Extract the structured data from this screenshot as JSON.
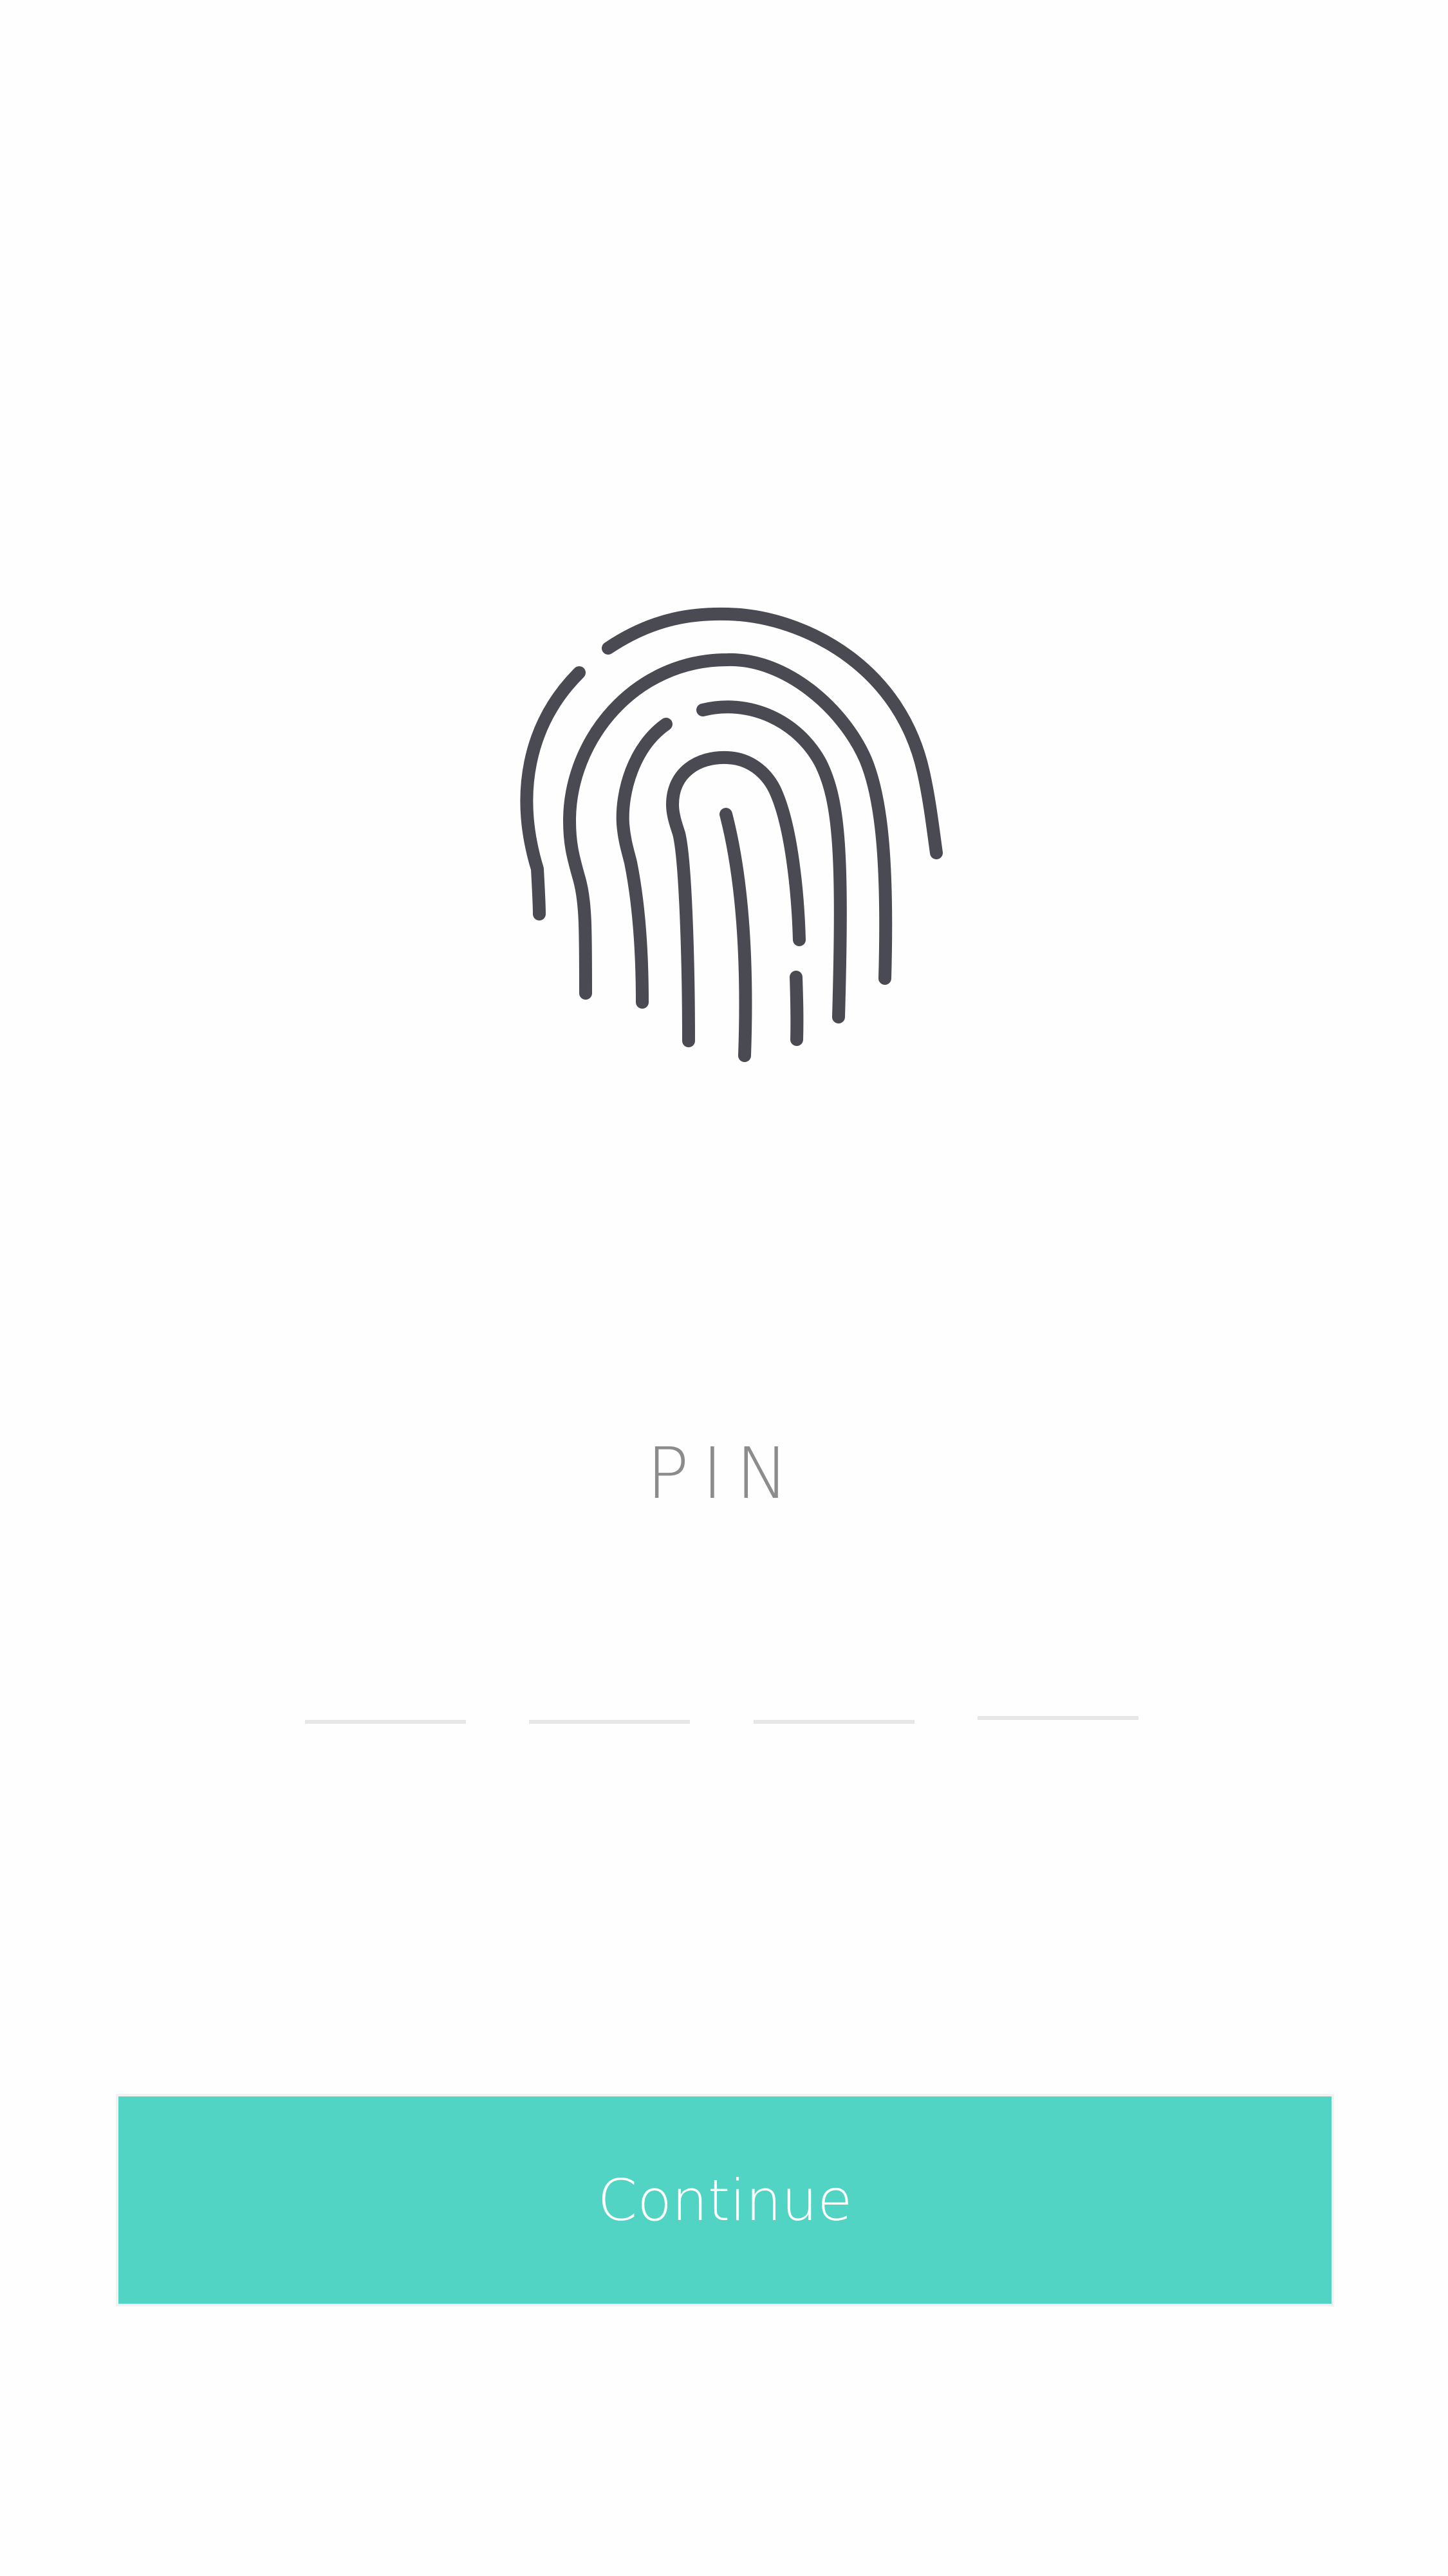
{
  "icons": {
    "fingerprint": "fingerprint-icon",
    "color": "#4a4a52"
  },
  "pin": {
    "label": "PIN",
    "digit_count": 4,
    "fields": [
      {
        "value": ""
      },
      {
        "value": ""
      },
      {
        "value": ""
      },
      {
        "value": ""
      }
    ],
    "underline_color": "#e6e6e6"
  },
  "actions": {
    "continue_label": "Continue",
    "continue_color": "#52d4c4"
  }
}
